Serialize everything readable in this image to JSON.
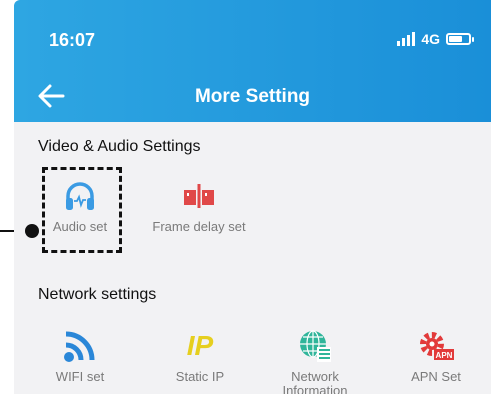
{
  "status_bar": {
    "time": "16:07",
    "network_type": "4G",
    "icons": [
      "signal-icon",
      "battery-icon"
    ]
  },
  "header": {
    "title": "More Setting",
    "back_icon": "arrow-left-icon"
  },
  "sections": {
    "video_audio": {
      "title": "Video & Audio Settings",
      "items": [
        {
          "label": "Audio set",
          "icon": "headphones-icon",
          "color": "#3b9be3"
        },
        {
          "label": "Frame delay set",
          "icon": "frame-delay-icon",
          "color": "#e04848"
        }
      ]
    },
    "network": {
      "title": "Network settings",
      "items": [
        {
          "label": "WIFI set",
          "icon": "wifi-icon",
          "color": "#2a87d8"
        },
        {
          "label": "Static IP",
          "icon": "static-ip-icon",
          "icon_text": "IP",
          "color": "#e6cf1f"
        },
        {
          "label": "Network Information",
          "icon": "globe-list-icon",
          "color": "#2fb59a"
        },
        {
          "label": "APN Set",
          "icon": "apn-gear-icon",
          "icon_text": "APN",
          "color": "#e23a3a"
        }
      ]
    }
  },
  "colors": {
    "header_start": "#2ea6e2",
    "header_end": "#1a8fd8",
    "background": "#f2f2f4",
    "label_gray": "#7a7a7a"
  }
}
